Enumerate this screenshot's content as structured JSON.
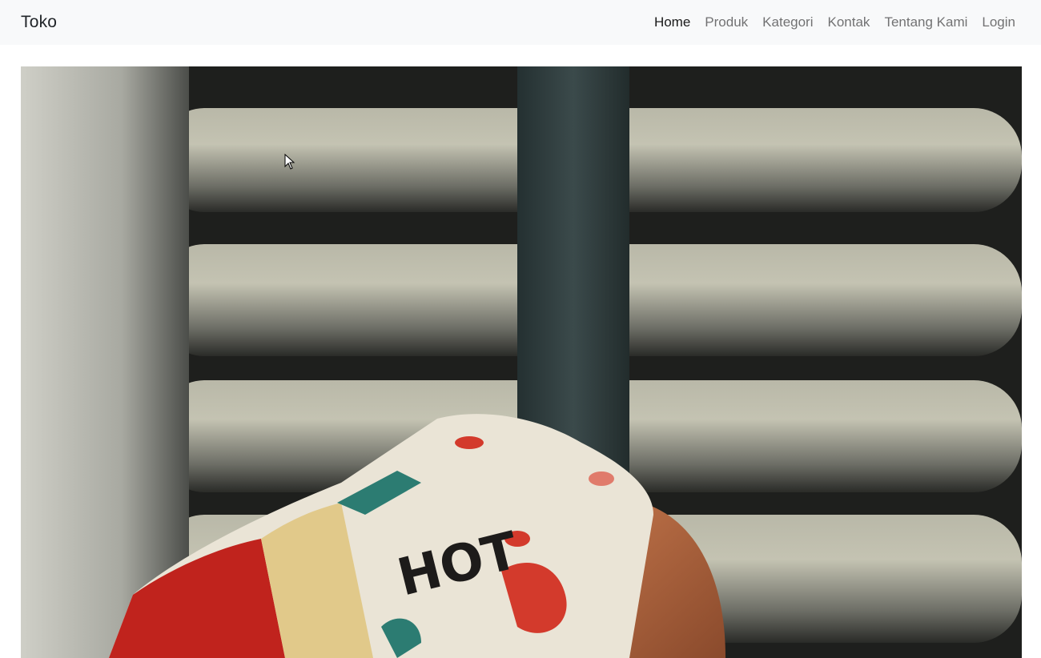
{
  "navbar": {
    "brand": "Toko",
    "items": [
      {
        "label": "Home",
        "active": true
      },
      {
        "label": "Produk",
        "active": false
      },
      {
        "label": "Kategori",
        "active": false
      },
      {
        "label": "Kontak",
        "active": false
      },
      {
        "label": "Tentang Kami",
        "active": false
      },
      {
        "label": "Login",
        "active": false
      }
    ]
  },
  "hero": {
    "bandana_text": "HOT"
  },
  "colors": {
    "navbar_bg": "#f8f9fa",
    "nav_link": "#7a7b7c",
    "nav_link_active": "#212529",
    "bandana_red": "#c0231d"
  }
}
